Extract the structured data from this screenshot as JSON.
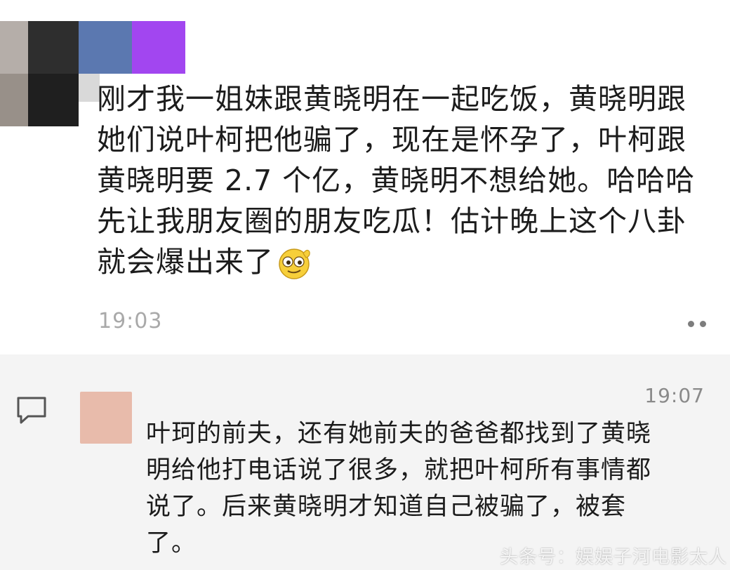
{
  "post": {
    "text": "刚才我一姐妹跟黄晓明在一起吃饭，黄晓明跟\n她们说叶柯把他骗了，现在是怀孕了，叶柯跟\n黄晓明要 2.7 个亿，黄晓明不想给她。哈哈哈\n先让我朋友圈的朋友吃瓜！估计晚上这个八卦\n就会爆出来了",
    "emoji": "sly-smile-emoji",
    "time": "19:03",
    "avatar_colors": [
      "#b5aea9",
      "#2e2e2e",
      "#eeeeee",
      "#5b78b0",
      "#a246f0",
      "#989089",
      "#1f1f1f",
      "#d9d9d9"
    ]
  },
  "comment": {
    "time": "19:07",
    "text": "叶珂的前夫，还有她前夫的爸爸都找到了黄晓\n明给他打电话说了很多，就把叶柯所有事情都\n说了。后来黄晓明才知道自己被骗了，被套\n了。",
    "avatar_color": "#e8bbab"
  },
  "watermark": "头条号：娱娱子河电影太人"
}
